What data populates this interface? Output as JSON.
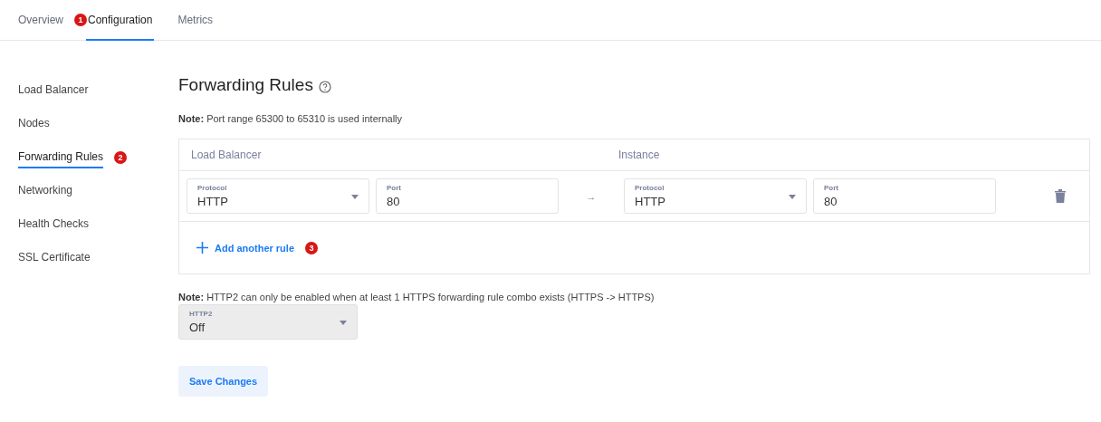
{
  "tabs": [
    {
      "label": "Overview",
      "selected": false
    },
    {
      "label": "Configuration",
      "selected": true,
      "marker": "1"
    },
    {
      "label": "Metrics",
      "selected": false
    }
  ],
  "sidebar": {
    "items": [
      {
        "label": "Load Balancer",
        "selected": false
      },
      {
        "label": "Nodes",
        "selected": false
      },
      {
        "label": "Forwarding Rules",
        "selected": true,
        "marker": "2"
      },
      {
        "label": "Networking",
        "selected": false
      },
      {
        "label": "Health Checks",
        "selected": false
      },
      {
        "label": "SSL Certificate",
        "selected": false
      }
    ]
  },
  "main": {
    "title": "Forwarding Rules",
    "note": "**Note:** Port range 65300 to 65310 is used internally",
    "rules_table": {
      "columns": [
        "Load Balancer",
        "Instance"
      ],
      "rows": [
        {
          "lb_protocol": {
            "label": "Protocol",
            "value": "HTTP"
          },
          "lb_port": {
            "label": "Port",
            "value": "80"
          },
          "arrow": "→",
          "instance_protocol": {
            "label": "Protocol",
            "value": "HTTP"
          },
          "instance_port": {
            "label": "Port",
            "value": "80"
          }
        }
      ],
      "add_button": {
        "label": "Add another rule",
        "marker": "3"
      }
    },
    "http2_note": "**Note:** HTTP2 can only be enabled when at least 1 HTTPS forwarding rule combo exists (HTTPS -> HTTPS)",
    "http2_select": {
      "label": "HTTP2",
      "value": "Off",
      "disabled": true
    },
    "save_button": "Save Changes"
  }
}
